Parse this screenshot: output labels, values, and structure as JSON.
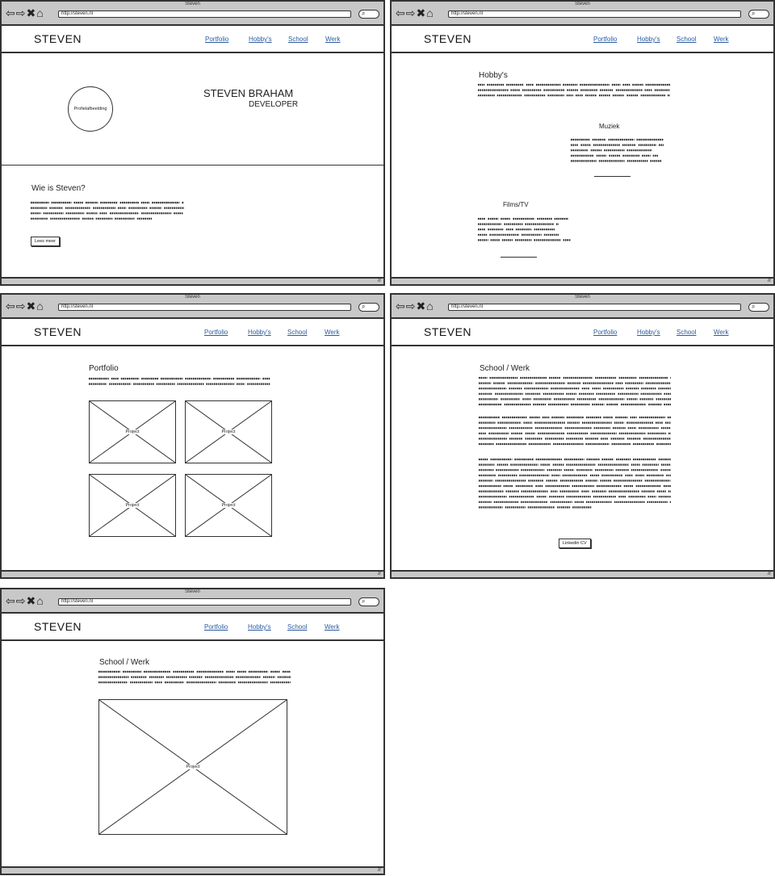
{
  "browser": {
    "window_title": "Steven",
    "url": "http://steven.nl",
    "nav_glyphs": "⇦⇨✖⌂",
    "search_glyph": "⌕"
  },
  "site": {
    "logo": "STEVEN",
    "nav": [
      "Portfolio",
      "Hobby's",
      "School",
      "Werk"
    ]
  },
  "screens": {
    "home": {
      "profile_label": "Profielafbeelding",
      "name": "STEVEN BRAHAM",
      "role": "DEVELOPER",
      "about_heading": "Wie is Steven?",
      "read_more": "Lees meer"
    },
    "hobbies": {
      "heading": "Hobby's",
      "music": "Muziek",
      "films": "Films/TV"
    },
    "portfolio": {
      "heading": "Portfolio",
      "projects": [
        "Project",
        "Project",
        "Project",
        "Project"
      ]
    },
    "school": {
      "heading": "School / Werk",
      "button": "Linkedin CV"
    },
    "work": {
      "heading": "School / Werk",
      "project": "Project"
    }
  },
  "colors": {
    "link": "#2b5c9e",
    "chrome": "#c8c8c8",
    "ink": "#333333"
  }
}
